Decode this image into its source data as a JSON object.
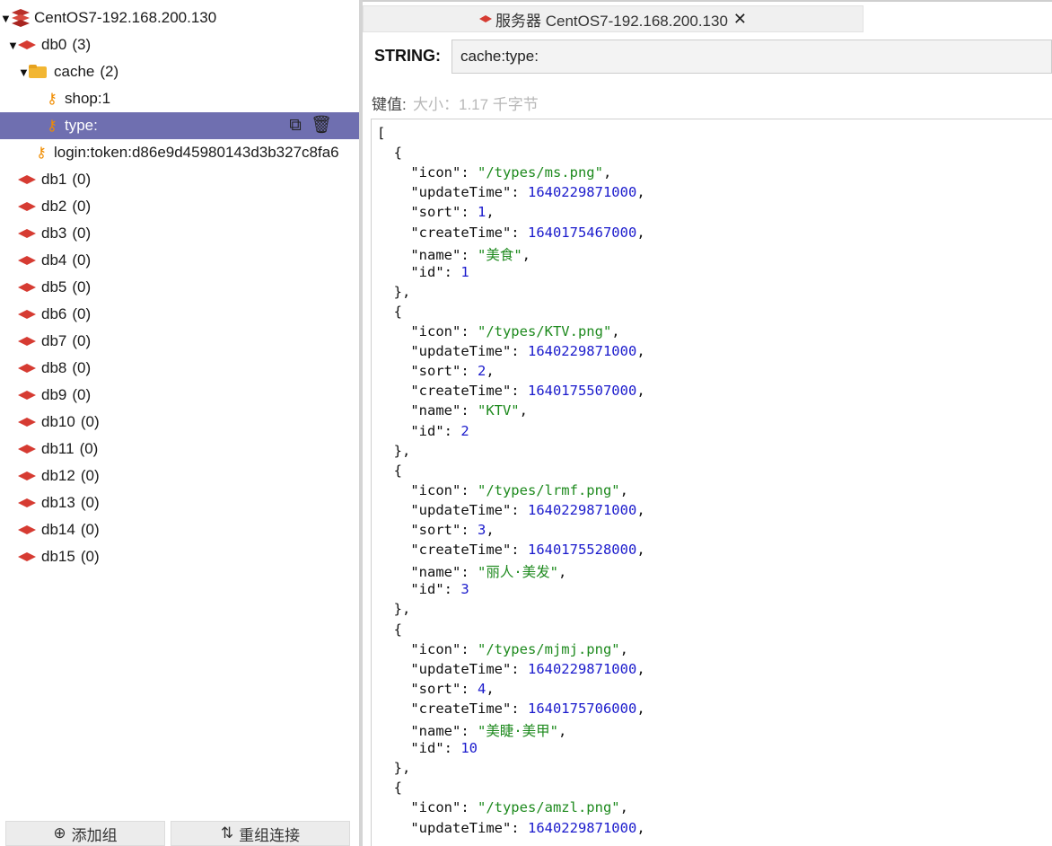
{
  "sidebar": {
    "server": {
      "label": "CentOS7-192.168.200.130"
    },
    "db0": {
      "label": "db0",
      "count": "(3)"
    },
    "cache_folder": {
      "label": "cache",
      "count": "(2)"
    },
    "keys": {
      "shop": "shop:1",
      "type": "type:",
      "login": "login:token:d86e9d45980143d3b327c8fa6"
    },
    "dbs": [
      {
        "label": "db1",
        "count": "(0)"
      },
      {
        "label": "db2",
        "count": "(0)"
      },
      {
        "label": "db3",
        "count": "(0)"
      },
      {
        "label": "db4",
        "count": "(0)"
      },
      {
        "label": "db5",
        "count": "(0)"
      },
      {
        "label": "db6",
        "count": "(0)"
      },
      {
        "label": "db7",
        "count": "(0)"
      },
      {
        "label": "db8",
        "count": "(0)"
      },
      {
        "label": "db9",
        "count": "(0)"
      },
      {
        "label": "db10",
        "count": "(0)"
      },
      {
        "label": "db11",
        "count": "(0)"
      },
      {
        "label": "db12",
        "count": "(0)"
      },
      {
        "label": "db13",
        "count": "(0)"
      },
      {
        "label": "db14",
        "count": "(0)"
      },
      {
        "label": "db15",
        "count": "(0)"
      }
    ],
    "footer": {
      "add_group": "添加组",
      "reconnect": "重组连接"
    }
  },
  "tab": {
    "title": "服务器 CentOS7-192.168.200.130",
    "close": "✕"
  },
  "key_view": {
    "type_label": "STRING:",
    "key_value": "cache:type:",
    "value_label": "键值:",
    "size_label": "大小：1.17 千字节"
  },
  "editor": {
    "items": [
      {
        "icon": "/types/ms.png",
        "updateTime": 1640229871000,
        "sort": 1,
        "createTime": 1640175467000,
        "name": "美食",
        "id": 1
      },
      {
        "icon": "/types/KTV.png",
        "updateTime": 1640229871000,
        "sort": 2,
        "createTime": 1640175507000,
        "name": "KTV",
        "id": 2
      },
      {
        "icon": "/types/lrmf.png",
        "updateTime": 1640229871000,
        "sort": 3,
        "createTime": 1640175528000,
        "name": "丽人·美发",
        "id": 3
      },
      {
        "icon": "/types/mjmj.png",
        "updateTime": 1640229871000,
        "sort": 4,
        "createTime": 1640175706000,
        "name": "美睫·美甲",
        "id": 10
      },
      {
        "icon": "/types/amzl.png",
        "updateTime": 1640229871000
      }
    ]
  },
  "colors": {
    "selected_row": "#6f6fb0",
    "redis_red": "#d63b32",
    "json_string": "#1e8a1e",
    "json_number": "#1a1acc"
  },
  "icons": {
    "server": "redis-stack-icon",
    "db": "redis-diamond-icon",
    "folder": "folder-icon",
    "key": "key-icon",
    "copy": "copy-icon",
    "delete": "trash-icon",
    "add": "plus-circle-icon",
    "reconnect": "swap-arrows-icon"
  }
}
